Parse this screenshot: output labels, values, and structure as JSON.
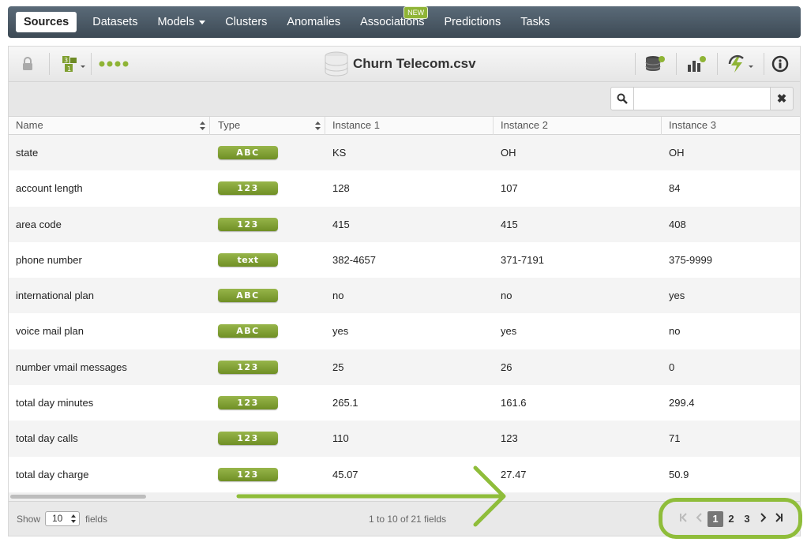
{
  "nav": {
    "items": [
      {
        "label": "Sources",
        "active": true
      },
      {
        "label": "Datasets"
      },
      {
        "label": "Models",
        "dropdown": true
      },
      {
        "label": "Clusters"
      },
      {
        "label": "Anomalies"
      },
      {
        "label": "Associations",
        "badge": "NEW"
      },
      {
        "label": "Predictions"
      },
      {
        "label": "Tasks"
      }
    ]
  },
  "toolbar": {
    "title": "Churn Telecom.csv",
    "icons": [
      "lock-icon",
      "source-config-icon",
      "more-dots-icon",
      "dataset-icon",
      "model-icon",
      "actions-icon",
      "info-icon"
    ]
  },
  "search": {
    "value": "",
    "placeholder": "",
    "clear_label": "✖"
  },
  "table": {
    "columns": [
      "Name",
      "Type",
      "Instance 1",
      "Instance 2",
      "Instance 3"
    ],
    "rows": [
      {
        "name": "state",
        "type": "ABC",
        "i1": "KS",
        "i2": "OH",
        "i3": "OH"
      },
      {
        "name": "account length",
        "type": "123",
        "i1": "128",
        "i2": "107",
        "i3": "84"
      },
      {
        "name": "area code",
        "type": "123",
        "i1": "415",
        "i2": "415",
        "i3": "408"
      },
      {
        "name": "phone number",
        "type": "text",
        "i1": "382-4657",
        "i2": "371-7191",
        "i3": "375-9999"
      },
      {
        "name": "international plan",
        "type": "ABC",
        "i1": "no",
        "i2": "no",
        "i3": "yes"
      },
      {
        "name": "voice mail plan",
        "type": "ABC",
        "i1": "yes",
        "i2": "yes",
        "i3": "no"
      },
      {
        "name": "number vmail messages",
        "type": "123",
        "i1": "25",
        "i2": "26",
        "i3": "0"
      },
      {
        "name": "total day minutes",
        "type": "123",
        "i1": "265.1",
        "i2": "161.6",
        "i3": "299.4"
      },
      {
        "name": "total day calls",
        "type": "123",
        "i1": "110",
        "i2": "123",
        "i3": "71"
      },
      {
        "name": "total day charge",
        "type": "123",
        "i1": "45.07",
        "i2": "27.47",
        "i3": "50.9"
      }
    ]
  },
  "footer": {
    "show_label": "Show",
    "page_size": "10",
    "fields_label": "fields",
    "count_text": "1 to 10 of 21 fields",
    "pages": [
      "1",
      "2",
      "3"
    ],
    "current_page": "1"
  },
  "colors": {
    "accent_green": "#8fbd3a",
    "nav_bg": "#4a5864",
    "badge_green": "#7f9f30"
  }
}
